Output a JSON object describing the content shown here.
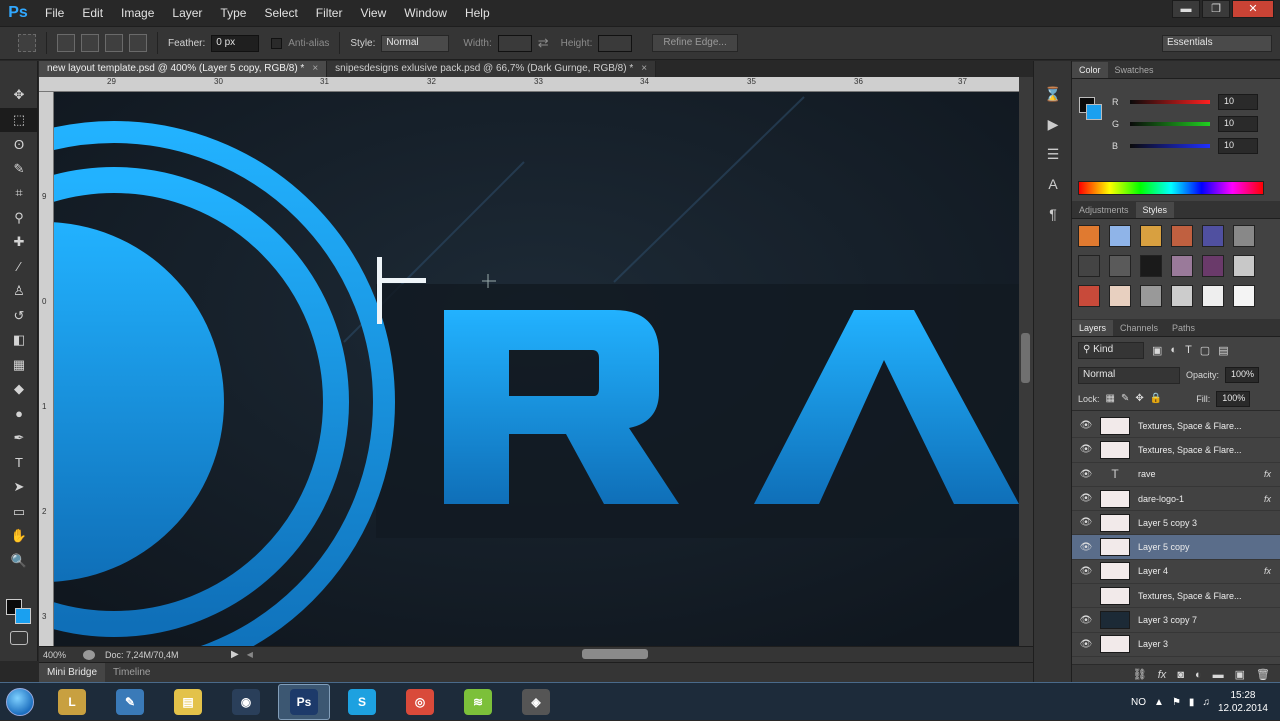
{
  "app": {
    "logo": "Ps"
  },
  "menu": [
    "File",
    "Edit",
    "Image",
    "Layer",
    "Type",
    "Select",
    "Filter",
    "View",
    "Window",
    "Help"
  ],
  "window_controls": {
    "minimize": "▬",
    "restore": "❐",
    "close": "✕"
  },
  "options": {
    "feather_label": "Feather:",
    "feather_value": "0 px",
    "antialias_label": "Anti-alias",
    "style_label": "Style:",
    "style_value": "Normal",
    "width_label": "Width:",
    "height_label": "Height:",
    "refine_edge": "Refine Edge...",
    "workspace": "Essentials"
  },
  "tools": [
    "move-tool",
    "marquee-tool",
    "lasso-tool",
    "quick-select-tool",
    "crop-tool",
    "eyedropper-tool",
    "healing-tool",
    "brush-tool",
    "stamp-tool",
    "history-brush-tool",
    "eraser-tool",
    "gradient-tool",
    "blur-tool",
    "dodge-tool",
    "pen-tool",
    "type-tool",
    "path-select-tool",
    "shape-tool",
    "hand-tool",
    "zoom-tool"
  ],
  "tool_glyphs": [
    "✥",
    "⬚",
    "ʘ",
    "✎",
    "⌗",
    "⚲",
    "✚",
    "∕",
    "♙",
    "↺",
    "◧",
    "▦",
    "◆",
    "●",
    "✒",
    "T",
    "➤",
    "▭",
    "✋",
    "🔍"
  ],
  "tabs": [
    {
      "label": "new layout template.psd @ 400% (Layer 5 copy, RGB/8) *",
      "close": "×"
    },
    {
      "label": "snipesdesigns exlusive pack.psd @ 66,7% (Dark Gurnge, RGB/8) *",
      "close": "×"
    }
  ],
  "ruler_ticks": [
    "29",
    "30",
    "31",
    "32",
    "33",
    "34",
    "35",
    "36",
    "37"
  ],
  "ruler_left_ticks": [
    "9",
    "0",
    "1",
    "2",
    "3"
  ],
  "canvas_text": "RA",
  "status": {
    "zoom": "400%",
    "doc": "Doc: 7,24M/70,4M"
  },
  "bridge": {
    "tab1": "Mini Bridge",
    "tab2": "Timeline"
  },
  "color_panel": {
    "tabs": [
      "Color",
      "Swatches"
    ],
    "channels": [
      {
        "label": "R",
        "value": "10"
      },
      {
        "label": "G",
        "value": "10"
      },
      {
        "label": "B",
        "value": "10"
      }
    ]
  },
  "styles_panel": {
    "tabs": [
      "Adjustments",
      "Styles"
    ]
  },
  "layers_panel": {
    "tabs": [
      "Layers",
      "Channels",
      "Paths"
    ],
    "kind": "Kind",
    "blend_mode": "Normal",
    "opacity_label": "Opacity:",
    "opacity": "100%",
    "lock_label": "Lock:",
    "fill_label": "Fill:",
    "fill": "100%",
    "layers": [
      {
        "name": "Textures, Space & Flare...",
        "fx": "",
        "visible": true,
        "kind": "pixel"
      },
      {
        "name": "Textures, Space & Flare...",
        "fx": "",
        "visible": true,
        "kind": "pixel"
      },
      {
        "name": "rave",
        "fx": "fx",
        "visible": true,
        "kind": "type"
      },
      {
        "name": "dare-logo-1",
        "fx": "fx",
        "visible": true,
        "kind": "pixel"
      },
      {
        "name": "Layer 5 copy 3",
        "fx": "",
        "visible": true,
        "kind": "pixel"
      },
      {
        "name": "Layer 5 copy",
        "fx": "",
        "visible": true,
        "kind": "pixel",
        "selected": true
      },
      {
        "name": "Layer 4",
        "fx": "fx",
        "visible": true,
        "kind": "pixel"
      },
      {
        "name": "Textures, Space & Flare...",
        "fx": "",
        "visible": false,
        "kind": "pixel"
      },
      {
        "name": "Layer 3 copy 7",
        "fx": "",
        "visible": true,
        "kind": "dark"
      },
      {
        "name": "Layer 3",
        "fx": "",
        "visible": true,
        "kind": "pixel"
      }
    ]
  },
  "taskbar": {
    "apps": [
      {
        "name": "league-of-legends",
        "glyph": "L",
        "color": "#c8a040"
      },
      {
        "name": "pen-tablet-app",
        "glyph": "✎",
        "color": "#3a7ab8"
      },
      {
        "name": "explorer",
        "glyph": "▤",
        "color": "#e3c24a"
      },
      {
        "name": "steam-like-app",
        "glyph": "◉",
        "color": "#2a3f5a"
      },
      {
        "name": "photoshop",
        "glyph": "Ps",
        "color": "#1d3a6a"
      },
      {
        "name": "skype",
        "glyph": "S",
        "color": "#1da1e0"
      },
      {
        "name": "chrome",
        "glyph": "◎",
        "color": "#d94a3a"
      },
      {
        "name": "spotify",
        "glyph": "≋",
        "color": "#7cc03a"
      },
      {
        "name": "screenshot-app",
        "glyph": "◈",
        "color": "#555"
      }
    ],
    "lang": "NO",
    "time": "15:28",
    "date": "12.02.2014"
  },
  "colors": {
    "accent": "#1aa0f0",
    "selected_layer": "#5a6d8a"
  }
}
